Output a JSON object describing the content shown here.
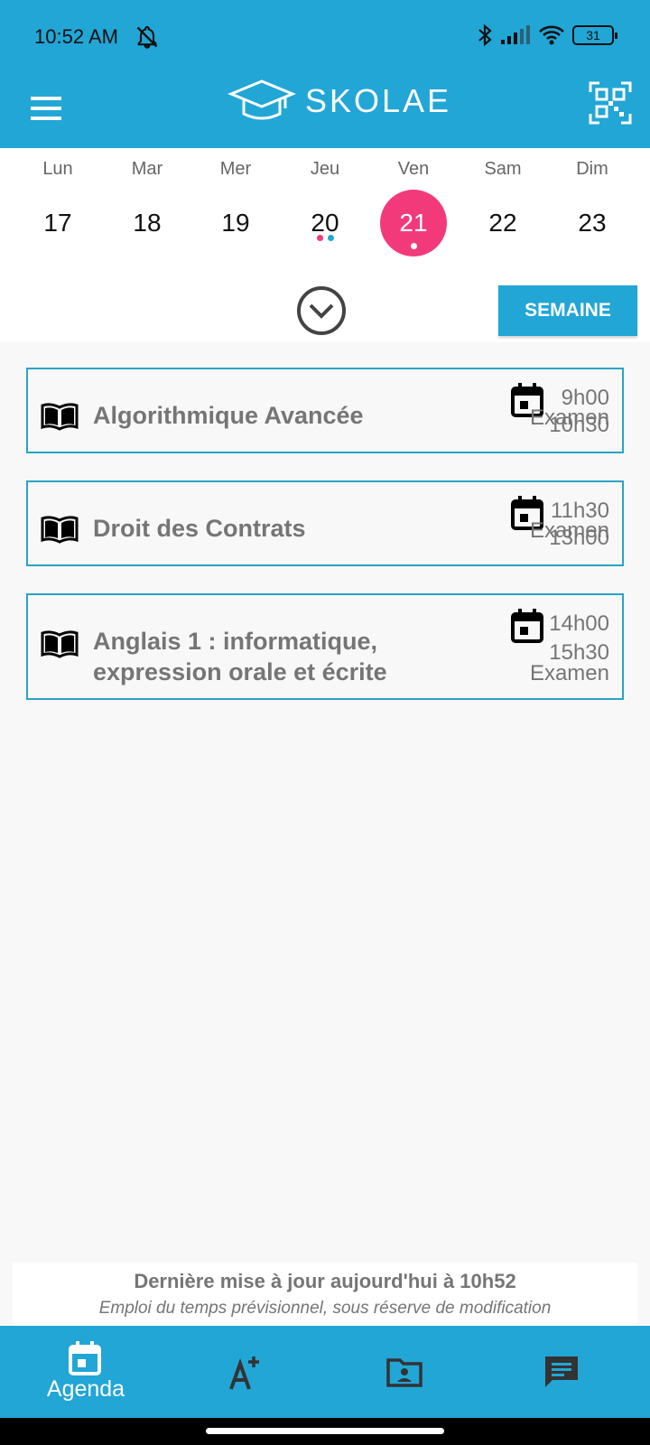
{
  "status": {
    "time": "10:52 AM",
    "battery": "31"
  },
  "app": {
    "name": "SKOLAE"
  },
  "week": {
    "days": [
      {
        "label": "Lun",
        "num": "17"
      },
      {
        "label": "Mar",
        "num": "18"
      },
      {
        "label": "Mer",
        "num": "19"
      },
      {
        "label": "Jeu",
        "num": "20"
      },
      {
        "label": "Ven",
        "num": "21"
      },
      {
        "label": "Sam",
        "num": "22"
      },
      {
        "label": "Dim",
        "num": "23"
      }
    ],
    "selected_day": "21",
    "view_button": "SEMAINE"
  },
  "courses": [
    {
      "title": "Algorithmique Avancée",
      "start": "9h00",
      "end": "10h30",
      "type": "Examen"
    },
    {
      "title": "Droit des Contrats",
      "start": "11h30",
      "end": "13h00",
      "type": "Examen"
    },
    {
      "title": "Anglais 1 : informatique, expression orale et écrite",
      "start": "14h00",
      "end": "15h30",
      "type": "Examen"
    }
  ],
  "footer": {
    "update": "Dernière mise à jour aujourd'hui à 10h52",
    "note": "Emploi du temps prévisionnel, sous réserve de modification"
  },
  "nav": {
    "agenda": "Agenda"
  },
  "colors": {
    "primary": "#21a6d6",
    "selected": "#f23a7b",
    "dot_pink": "#f23a7b",
    "dot_blue": "#21a6d6",
    "card_border": "#2aa3c4"
  },
  "icons": [
    "menu-icon",
    "graduation-cap-icon",
    "qr-code-icon",
    "chevron-down-circle-icon",
    "book-icon",
    "calendar-icon",
    "grade-plus-icon",
    "contact-folder-icon",
    "chat-icon"
  ]
}
